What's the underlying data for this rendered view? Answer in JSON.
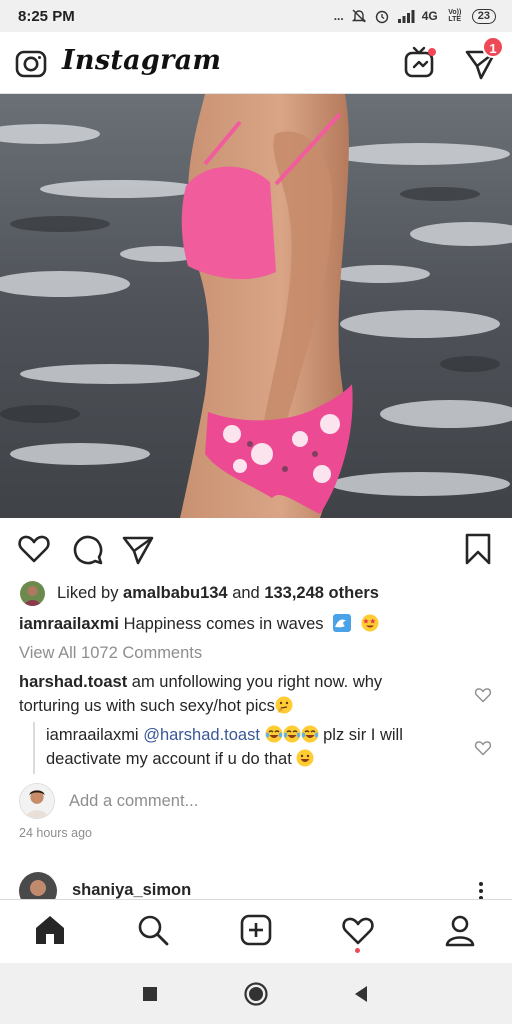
{
  "status_bar": {
    "time": "8:25 PM",
    "dots": "...",
    "network": "4G",
    "network_small": "Vo)) LTE",
    "battery": "23"
  },
  "header": {
    "logo": "Instagram",
    "icons": [
      "camera-icon",
      "igtv-icon",
      "direct-message-icon"
    ],
    "dm_badge": "1"
  },
  "post": {
    "liked_by_prefix": "Liked by ",
    "liked_by_user": "amalbabu134",
    "liked_by_and": " and ",
    "liked_by_others": "133,248 others",
    "caption_user": "iamraailaxmi",
    "caption_text": " Happiness comes in waves ",
    "view_all": "View All 1072 Comments",
    "comments": [
      {
        "user": "harshad.toast",
        "text": " am unfollowing you right now. why torturing us with such sexy/hot pics"
      },
      {
        "user": "iamraailaxmi",
        "mention": "@harshad.toast",
        "text": " plz sir I will deactivate my account if u do that "
      }
    ],
    "add_comment_placeholder": "Add a comment...",
    "timestamp": "24 hours ago"
  },
  "next_post": {
    "username": "shaniya_simon"
  },
  "bottom_nav": {
    "items": [
      "home-icon",
      "search-icon",
      "new-post-icon",
      "activity-icon",
      "profile-icon"
    ]
  },
  "colors": {
    "accent_red": "#ed4956",
    "mention_blue": "#385898",
    "muted_gray": "#8e8e8e"
  }
}
